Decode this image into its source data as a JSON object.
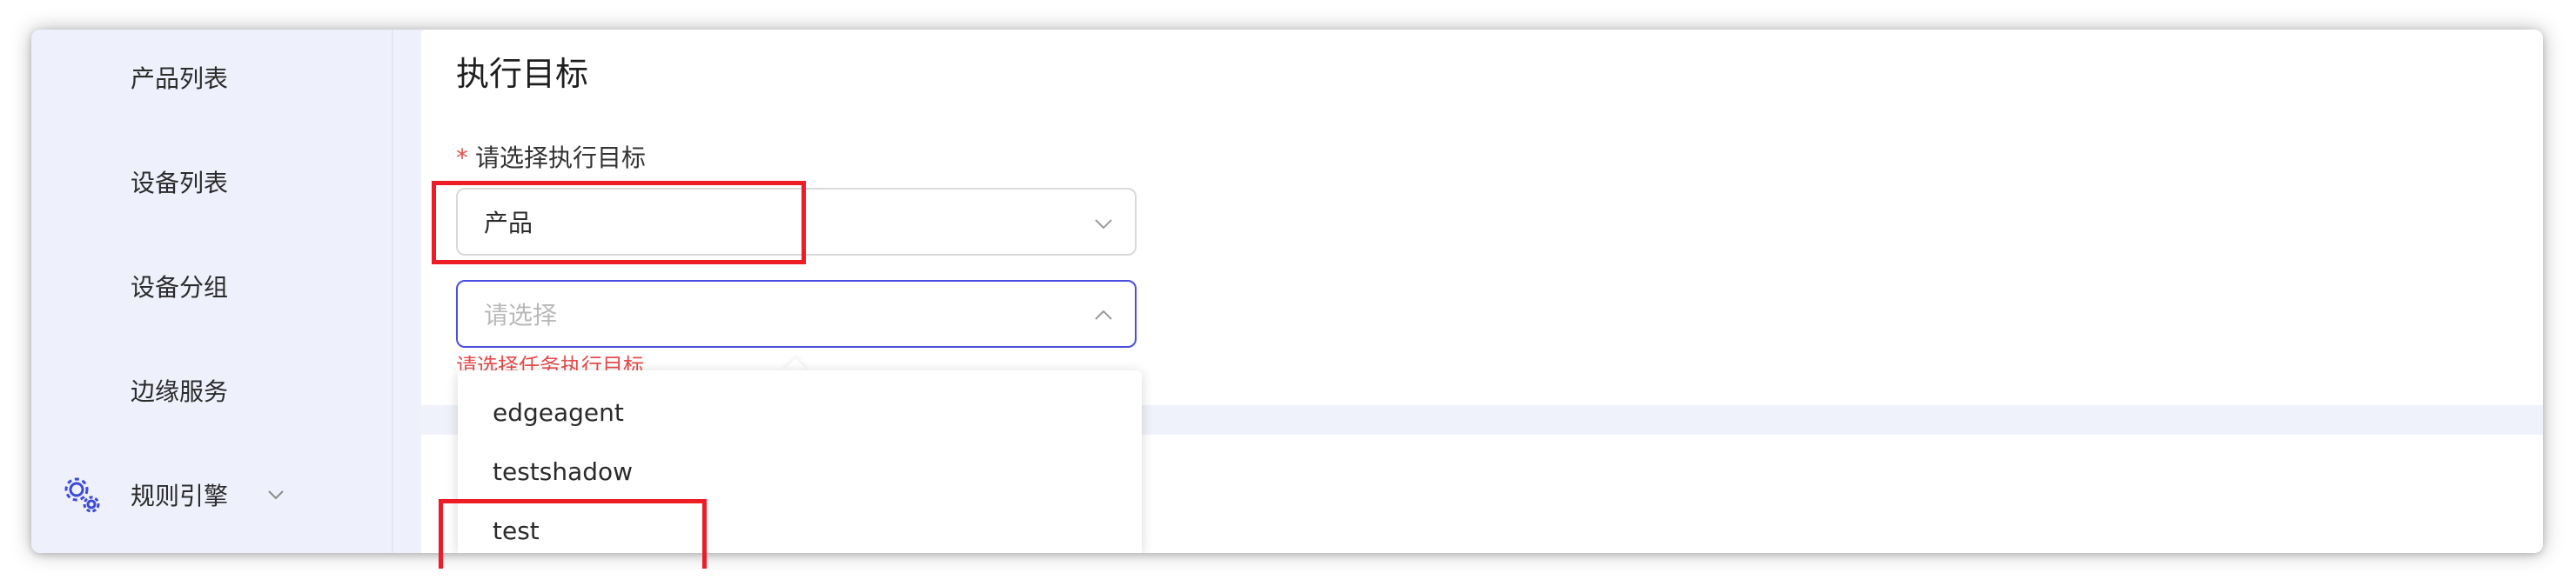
{
  "sidebar": {
    "items": [
      {
        "label": "产品列表"
      },
      {
        "label": "设备列表"
      },
      {
        "label": "设备分组"
      },
      {
        "label": "边缘服务"
      },
      {
        "label": "规则引擎",
        "icon": "gear-icon",
        "expand_icon": "chevron-down-icon"
      }
    ]
  },
  "main": {
    "section_title": "执行目标",
    "field": {
      "required_marker": "*",
      "label": "请选择执行目标"
    },
    "product_select": {
      "value": "产品"
    },
    "target_select": {
      "placeholder": "请选择",
      "state": "open"
    },
    "error_message": "请选择任务执行目标",
    "dropdown": {
      "options": [
        {
          "label": "edgeagent"
        },
        {
          "label": "testshadow"
        },
        {
          "label": "test"
        }
      ]
    }
  },
  "colors": {
    "accent": "#4a4ee0",
    "error": "#e34d4d",
    "annotation": "#ee1c25",
    "sidebar_bg": "#eef0fb"
  }
}
